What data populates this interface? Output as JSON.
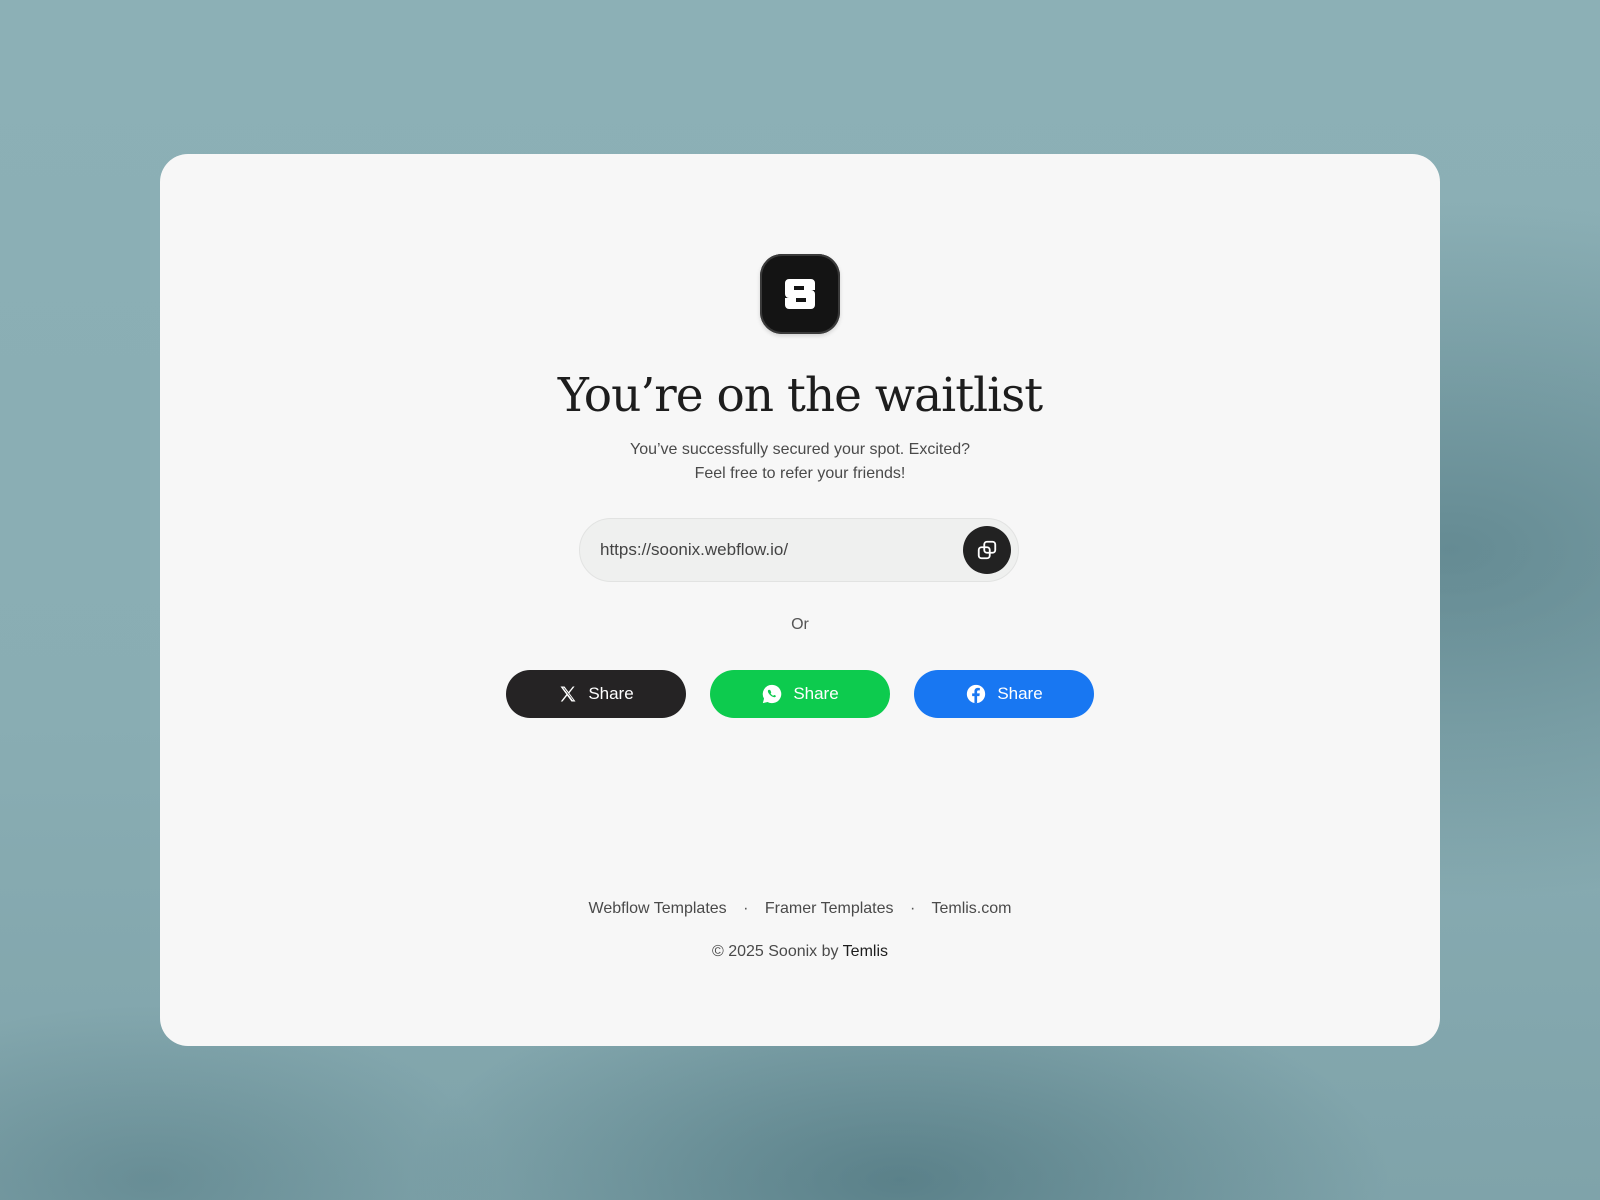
{
  "heading": {
    "title": "You’re on the waitlist",
    "subtitle_line1": "You’ve successfully secured your spot. Excited?",
    "subtitle_line2": "Feel free to refer your friends!"
  },
  "referral": {
    "url": "https://soonix.webflow.io/",
    "copy_icon": "copy-icon"
  },
  "divider_text": "Or",
  "share_buttons": [
    {
      "label": "Share",
      "icon": "x-logo-icon",
      "color": "#252324"
    },
    {
      "label": "Share",
      "icon": "whatsapp-icon",
      "color": "#0dcb4e"
    },
    {
      "label": "Share",
      "icon": "facebook-icon",
      "color": "#1877f2"
    }
  ],
  "footer": {
    "links": [
      "Webflow Templates",
      "Framer Templates",
      "Temlis.com"
    ],
    "separator": "·",
    "copyright_prefix": "© 2025 Soonix by",
    "copyright_brand": "Temlis"
  },
  "logo": {
    "icon": "soonix-logo-icon",
    "background": "#141414"
  }
}
